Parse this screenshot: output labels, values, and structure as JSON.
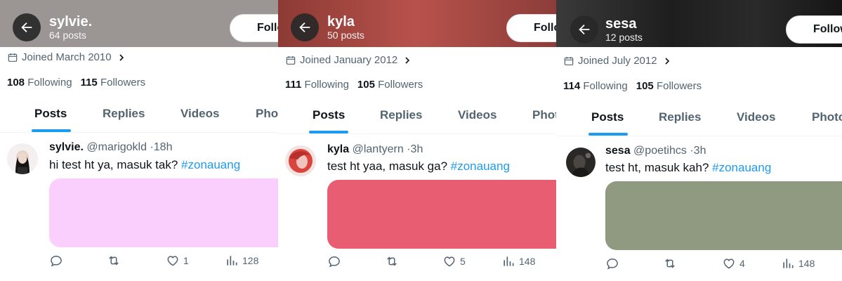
{
  "panels": [
    {
      "header": {
        "name": "sylvie.",
        "posts": "64 posts",
        "follow": "Follow",
        "bg": "#9b9594"
      },
      "joined": "Joined March 2010",
      "following_count": "108",
      "following_label": "Following",
      "followers_count": "115",
      "followers_label": "Followers",
      "tabs": [
        "Posts",
        "Replies",
        "Videos",
        "Photos"
      ],
      "tweet": {
        "name": "sylvie.",
        "handle": "@marigokld",
        "sep": "·",
        "time": "18h",
        "text": "hi test ht ya, masuk tak? ",
        "hashtag": "#zonauang",
        "media_color": "#fbcffd",
        "replies": "",
        "retweets": "",
        "likes": "1",
        "views": "128"
      }
    },
    {
      "header": {
        "name": "kyla",
        "posts": "50 posts",
        "follow": "Follow",
        "bg": "#a8433f"
      },
      "joined": "Joined January 2012",
      "following_count": "111",
      "following_label": "Following",
      "followers_count": "105",
      "followers_label": "Followers",
      "tabs": [
        "Posts",
        "Replies",
        "Videos",
        "Photos"
      ],
      "tweet": {
        "name": "kyla",
        "handle": "@lantyern",
        "sep": "·",
        "time": "3h",
        "text": "test ht yaa, masuk ga? ",
        "hashtag": "#zonauang",
        "media_color": "#e85d72",
        "replies": "",
        "retweets": "",
        "likes": "5",
        "views": "148"
      }
    },
    {
      "header": {
        "name": "sesa",
        "posts": "12 posts",
        "follow": "Follow",
        "bg": "#262626"
      },
      "joined": "Joined July 2012",
      "following_count": "114",
      "following_label": "Following",
      "followers_count": "105",
      "followers_label": "Followers",
      "tabs": [
        "Posts",
        "Replies",
        "Videos",
        "Photos"
      ],
      "tweet": {
        "name": "sesa",
        "handle": "@poetihcs",
        "sep": "·",
        "time": "3h",
        "text": "test ht, masuk kah? ",
        "hashtag": "#zonauang",
        "media_color": "#8f9a80",
        "replies": "",
        "retweets": "",
        "likes": "4",
        "views": "148"
      }
    }
  ],
  "theme": {
    "accent": "#1d9bf0",
    "muted": "#536471",
    "text": "#0f1419"
  },
  "icons": {
    "back": "arrow-left-icon",
    "calendar": "calendar-icon",
    "reply": "reply-icon",
    "retweet": "retweet-icon",
    "like": "heart-icon",
    "views": "views-icon"
  }
}
